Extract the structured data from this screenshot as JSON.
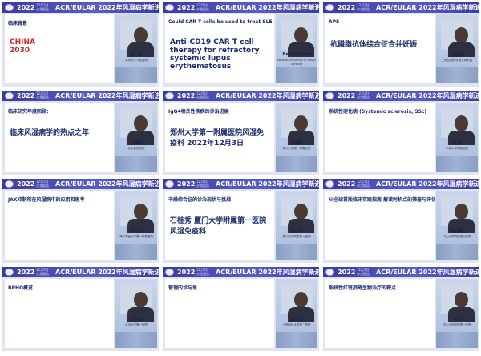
{
  "banner": {
    "year": "2022",
    "date": "12月3日 沙龙报告",
    "title": "ACR/EULAR 2022年风湿病学新进展研讨会"
  },
  "tiles": [
    {
      "slide_title": "临床背景",
      "slide_big_label": "CHINA\n2030",
      "speaker": "曹小峰",
      "affil": "北京大学人民医院"
    },
    {
      "slide_title": "Could CAR T cells be used to treat SLE patients?",
      "slide_big_label": "Anti-CD19 CAR T cell therapy for refractory systemic lupus erythematosus",
      "speaker": "Betty P Tsao",
      "affil": "Medical University of South Carolina"
    },
    {
      "slide_title": "APS",
      "slide_big_label": "抗磷脂抗体综合征合并妊娠",
      "speaker": "吕亚楠",
      "affil": "上海交通大学医学院附属"
    },
    {
      "slide_title": "临床研究年度回顾：",
      "slide_big_label": "临床风湿病学的热点之年",
      "speaker": "张顺保",
      "affil": "北京协和医院"
    },
    {
      "slide_title": "IgG4相关性疾病的诊治进展",
      "slide_big_label": "郑州大学第一附属医院风湿免疫科 2022年12月3日",
      "speaker": "曹晓莉",
      "affil": "郑州大学第一附属医院"
    },
    {
      "slide_title": "系统性硬化病 (Systemic sclerosis, SSc)",
      "slide_big_label": "",
      "speaker": "傅 莉",
      "affil": "中南大学湘雅医院"
    },
    {
      "slide_title": "JAK抑制剂在风湿病中的应用和思考",
      "slide_big_label": "",
      "speaker": "赵东宝",
      "affil": "海军军医大学第一附属医院"
    },
    {
      "slide_title": "干燥综合征的诊治现状与挑战",
      "slide_big_label": "石桂秀 厦门大学附属第一医院风湿免疫科",
      "speaker": "石桂秀",
      "affil": "厦门大学附属第一医院"
    },
    {
      "slide_title": "从全球首版临床实践指南 解读时机点的筛查与评估",
      "slide_big_label": "",
      "speaker": "余日胜",
      "affil": "中山大学附属第三医院"
    },
    {
      "slide_title": "BPHO概览",
      "slide_big_label": "",
      "speaker": "汪大峰",
      "affil": "北京大学第一医院"
    },
    {
      "slide_title": "管理的诊与思",
      "slide_big_label": "",
      "speaker": "薛光泽",
      "affil": "山西医科大学第二医院"
    },
    {
      "slide_title": "系统性红斑狼疮生物治疗的靶点",
      "slide_big_label": "",
      "speaker": "王丽",
      "affil": "中山大学附属第一医院"
    }
  ],
  "colors": {
    "banner": "#3b3aa0",
    "accent_red": "#c62828"
  }
}
